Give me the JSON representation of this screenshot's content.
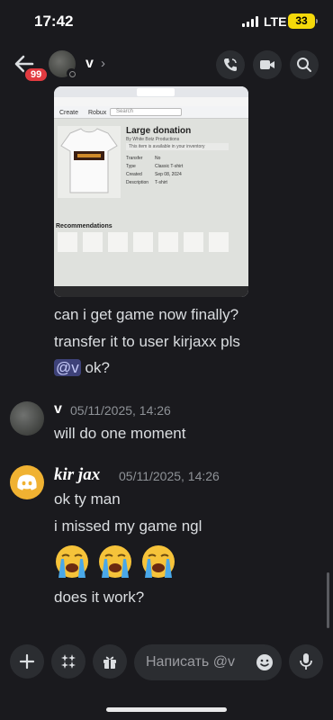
{
  "status_bar": {
    "time": "17:42",
    "network": "LTE",
    "battery": "33"
  },
  "header": {
    "unread_badge": "99",
    "channel_name": "v",
    "chevron": "›"
  },
  "attachment": {
    "title": "Large donation",
    "creator": "By White Botz Productions",
    "owned_note": "This item is available in your inventory",
    "fields": [
      {
        "label": "Transfer",
        "value": "No"
      },
      {
        "label": "Type",
        "value": "Classic T-shirt"
      },
      {
        "label": "Created",
        "value": "Sep 08, 2024"
      },
      {
        "label": "Description",
        "value": "T-shirt"
      }
    ],
    "tabs": [
      "Create",
      "Robux"
    ],
    "search_placeholder": "Search",
    "recommendations_heading": "Recommendations"
  },
  "messages": [
    {
      "continuation_lines": [
        "can i get game now finally?",
        "transfer it to user kirjaxx pls"
      ],
      "mention": "@v",
      "mention_tail": " ok?"
    }
  ],
  "v_message": {
    "author": "v",
    "timestamp": "05/11/2025, 14:26",
    "text": "will do one moment"
  },
  "kir_message": {
    "author": "kir jax",
    "timestamp": "05/11/2025, 14:26",
    "lines": [
      "ok ty man",
      "i missed my game ngl"
    ],
    "emoji_name": "loudly-crying-face",
    "emoji_count": 3,
    "last_line": "does it work?"
  },
  "composer": {
    "placeholder": "Написать @v"
  },
  "colors": {
    "accent": "#5865f2",
    "background": "#1a1a1e",
    "badge": "#e23b40",
    "battery": "#f5d90a",
    "discord_avatar": "#f0b232"
  }
}
